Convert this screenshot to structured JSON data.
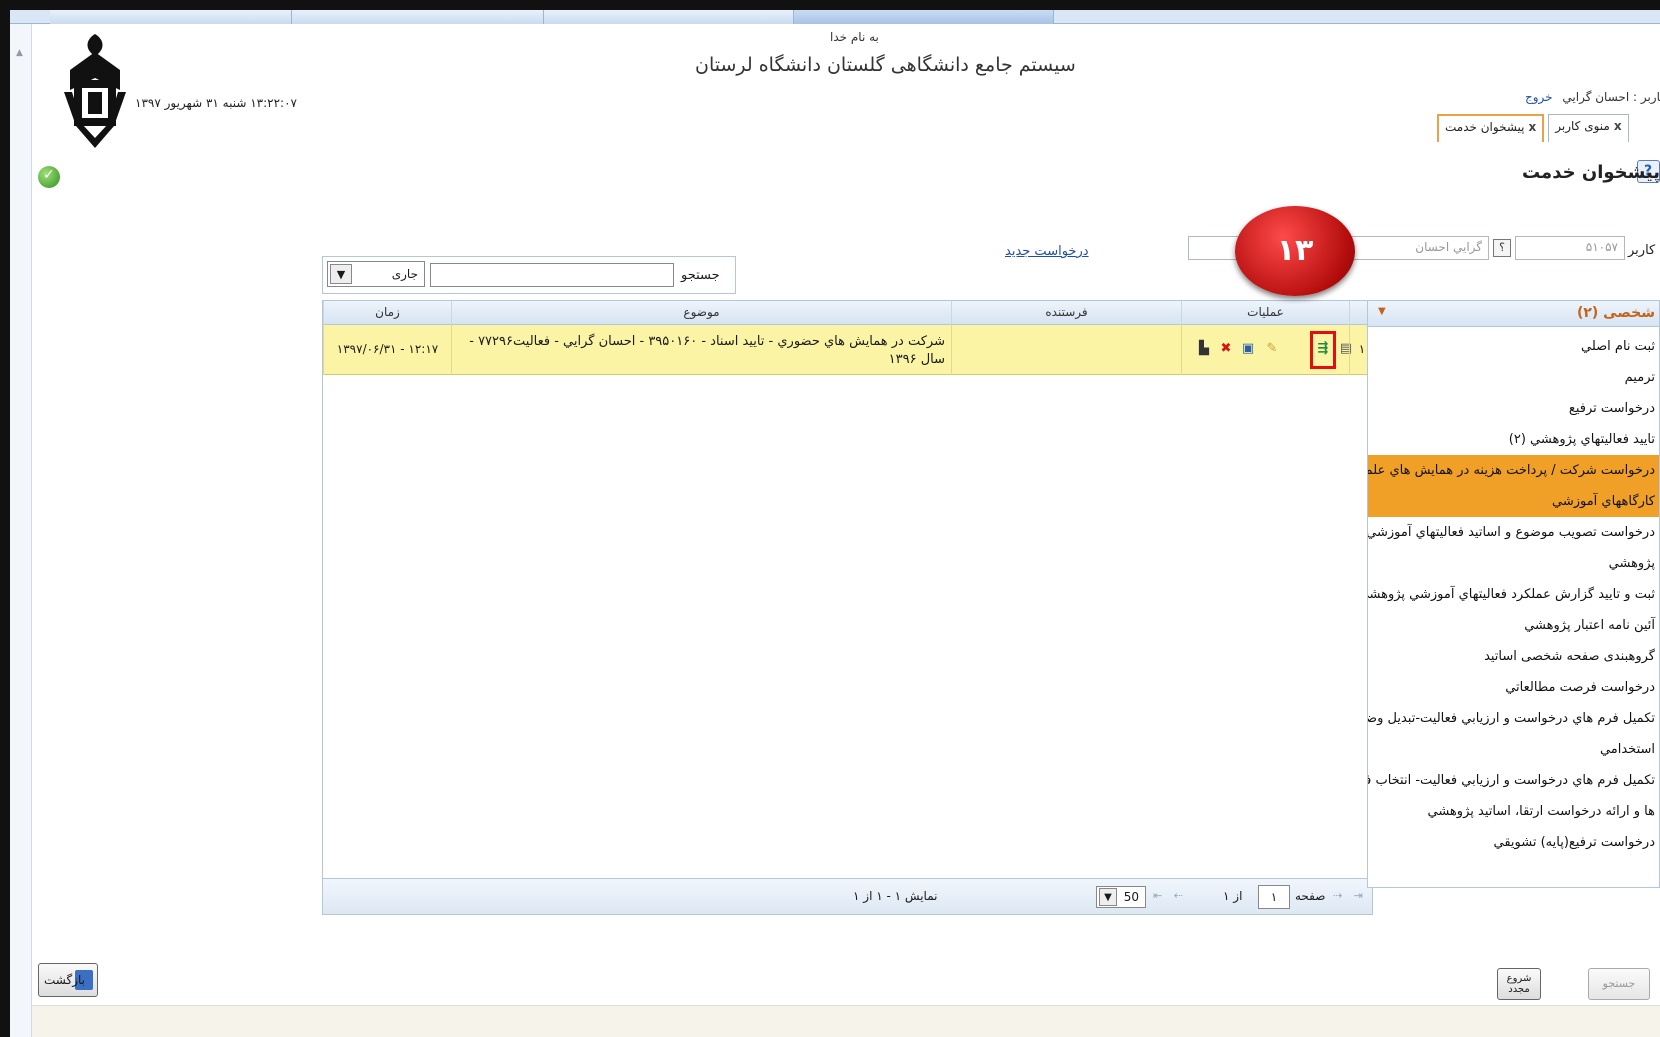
{
  "header": {
    "bismillah": "به نام خدا",
    "system_title": "سيستم جامع دانشگاهی گلستان   دانشگاه لرستان",
    "datetime": "۱۳:۲۲:۰۷ شنبه ۳۱ شهریور ۱۳۹۷"
  },
  "user": {
    "line": "کاربر : احسان گرايي",
    "logout": "خروج"
  },
  "tabs": [
    {
      "label": "منوی کاربر"
    },
    {
      "label": "پیشخوان خدمت"
    }
  ],
  "page_heading": "پیشخوان خدمت",
  "user_search": {
    "label": "کاربر",
    "id_value": "۵۱۰۵۷",
    "help": "؟",
    "name_value": "گرايي احسان"
  },
  "new_request": "درخواست جدید",
  "annotation_badge": "۱۳",
  "filter": {
    "search_label": "جستجو",
    "status_value": "جاری"
  },
  "grid": {
    "columns": [
      "عملیات",
      "فرستنده",
      "موضوع",
      "زمان"
    ],
    "rows": [
      {
        "num": "۱",
        "subject": "شركت در همايش هاي حضوري - تاييد اسناد - ۳۹۵۰۱۶۰ - احسان گرايي - فعالیت۷۷۲۹۶ - سال ۱۳۹۶",
        "sender": "",
        "time": "۱۳۹۷/۰۶/۳۱ - ۱۲:۱۷"
      }
    ],
    "pager": {
      "page_label": "صفحه",
      "page_value": "۱",
      "of_text": "از ۱",
      "page_size": "50",
      "showing": "نمايش ۱ - ۱ از ۱"
    }
  },
  "menu": {
    "title": "شخصی (۲)",
    "items": [
      {
        "label": "ثبت نام اصلي",
        "active": false
      },
      {
        "label": "ترميم",
        "active": false
      },
      {
        "label": "درخواست ترفيع",
        "active": false
      },
      {
        "label": "تاييد فعاليتهاي پژوهشي (۲)",
        "active": false
      },
      {
        "label": "درخواست شرکت / پرداخت هزينه در همايش هاي علمي و",
        "active": true
      },
      {
        "label": "کارگاههاي آموزشي",
        "active": true
      },
      {
        "label": "درخواست تصويب موضوع و اساتيد فعاليتهاي آموزشي-",
        "active": false
      },
      {
        "label": "پژوهشي",
        "active": false
      },
      {
        "label": "ثبت و تاييد گزارش عملكرد فعاليتهاي آموزشي پژوهشي",
        "active": false
      },
      {
        "label": "آئين نامه اعتبار پژوهشي",
        "active": false
      },
      {
        "label": "گروهبندی صفحه شخصی اساتید",
        "active": false
      },
      {
        "label": "درخواست فرصت مطالعاتي",
        "active": false
      },
      {
        "label": "تكميل فرم هاي درخواست و ارزيابي فعاليت-تبديل وضعيت",
        "active": false
      },
      {
        "label": "استخدامي",
        "active": false
      },
      {
        "label": "تكميل فرم هاي درخواست و ارزيابي فعاليت- انتخاب فعاليت",
        "active": false
      },
      {
        "label": "ها و ارائه درخواست ارتقا، اساتيد پژوهشي",
        "active": false
      },
      {
        "label": "درخواست ترفيع(پايه) تشويقي",
        "active": false
      }
    ]
  },
  "buttons": {
    "back": "بازگشت",
    "restart_line1": "شروع",
    "restart_line2": "مجدد",
    "search": "جستجو"
  },
  "colors": {
    "row_highlight": "#fbf4a4",
    "menu_active": "#f0a026",
    "badge": "#c81414",
    "link": "#1f4fa6"
  }
}
